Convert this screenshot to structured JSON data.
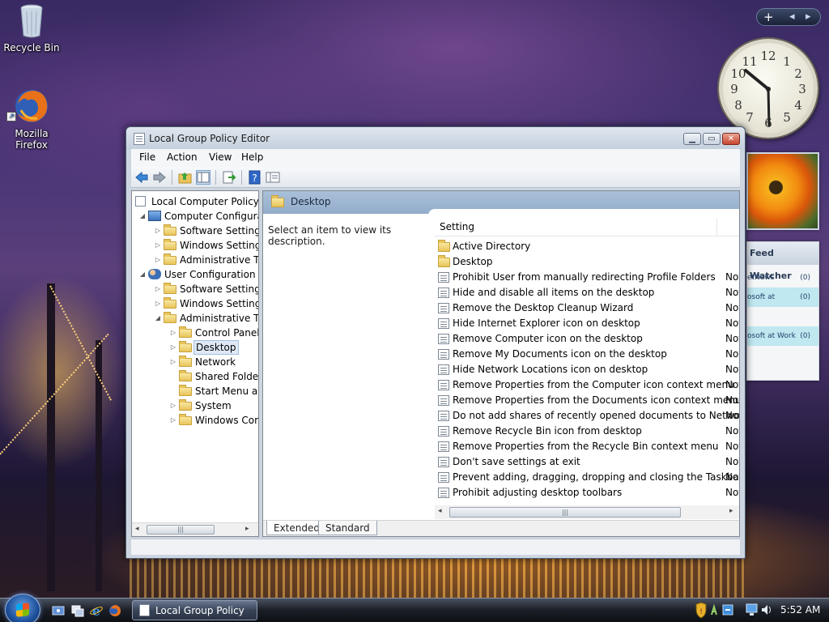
{
  "desktop": {
    "icons": [
      {
        "label": "Recycle Bin",
        "icon": "recycle-bin-icon"
      },
      {
        "label": "Mozilla Firefox",
        "icon": "firefox-icon"
      }
    ]
  },
  "gadgets": {
    "feed_watcher": {
      "title": "Feed Watcher",
      "rows": [
        {
          "text": "etNews",
          "count": "(0)"
        },
        {
          "text": "osoft at",
          "count": "(0)"
        },
        {
          "text": "",
          "count": ""
        },
        {
          "text": "osoft at Work",
          "count": "(0)"
        }
      ]
    }
  },
  "window": {
    "title": "Local Group Policy Editor",
    "menu": [
      "File",
      "Action",
      "View",
      "Help"
    ],
    "toolbar": [
      "back-icon",
      "forward-icon",
      "up-folder-icon",
      "show-hide-tree-icon",
      "export-list-icon",
      "help-icon",
      "properties-icon"
    ],
    "tree": [
      {
        "label": "Local Computer Policy",
        "icon": "policy-icon",
        "expander": ""
      },
      {
        "label": "Computer Configura",
        "icon": "computer-icon",
        "expander": "◢"
      },
      {
        "label": "Software Settings",
        "icon": "folder-icon",
        "expander": "▷"
      },
      {
        "label": "Windows Setting",
        "icon": "folder-icon",
        "expander": "▷"
      },
      {
        "label": "Administrative Te",
        "icon": "folder-icon",
        "expander": "▷"
      },
      {
        "label": "User Configuration",
        "icon": "users-icon",
        "expander": "◢"
      },
      {
        "label": "Software Settings",
        "icon": "folder-icon",
        "expander": "▷"
      },
      {
        "label": "Windows Setting",
        "icon": "folder-icon",
        "expander": "▷"
      },
      {
        "label": "Administrative Te",
        "icon": "folder-icon",
        "expander": "◢"
      },
      {
        "label": "Control Panel",
        "icon": "folder-icon",
        "expander": "▷"
      },
      {
        "label": "Desktop",
        "icon": "folder-icon",
        "expander": "▷",
        "selected": true
      },
      {
        "label": "Network",
        "icon": "folder-icon",
        "expander": "▷"
      },
      {
        "label": "Shared Folder",
        "icon": "folder-icon",
        "expander": ""
      },
      {
        "label": "Start Menu ar",
        "icon": "folder-icon",
        "expander": ""
      },
      {
        "label": "System",
        "icon": "folder-icon",
        "expander": "▷"
      },
      {
        "label": "Windows Cor",
        "icon": "folder-icon",
        "expander": "▷"
      }
    ],
    "right_header": "Desktop",
    "description": "Select an item to view its description.",
    "column_setting": "Setting",
    "settings": [
      {
        "name": "Active Directory",
        "type": "folder",
        "state": ""
      },
      {
        "name": "Desktop",
        "type": "folder",
        "state": ""
      },
      {
        "name": "Prohibit User from manually redirecting Profile Folders",
        "type": "policy",
        "state": "Not"
      },
      {
        "name": "Hide and disable all items on the desktop",
        "type": "policy",
        "state": "Not"
      },
      {
        "name": "Remove the Desktop Cleanup Wizard",
        "type": "policy",
        "state": "Not"
      },
      {
        "name": "Hide Internet Explorer icon on desktop",
        "type": "policy",
        "state": "Not"
      },
      {
        "name": "Remove Computer icon on the desktop",
        "type": "policy",
        "state": "Not"
      },
      {
        "name": "Remove My Documents icon on the desktop",
        "type": "policy",
        "state": "Not"
      },
      {
        "name": "Hide Network Locations icon on desktop",
        "type": "policy",
        "state": "Not"
      },
      {
        "name": "Remove Properties from the Computer icon context menu",
        "type": "policy",
        "state": "Not"
      },
      {
        "name": "Remove Properties from the Documents icon context menu",
        "type": "policy",
        "state": "Not"
      },
      {
        "name": "Do not add shares of recently opened documents to Networ...",
        "type": "policy",
        "state": "Not"
      },
      {
        "name": "Remove Recycle Bin icon from desktop",
        "type": "policy",
        "state": "Not"
      },
      {
        "name": "Remove Properties from the Recycle Bin context menu",
        "type": "policy",
        "state": "Not"
      },
      {
        "name": "Don't save settings at exit",
        "type": "policy",
        "state": "Not"
      },
      {
        "name": "Prevent adding, dragging, dropping and closing the Taskbar...",
        "type": "policy",
        "state": "Not"
      },
      {
        "name": "Prohibit adjusting desktop toolbars",
        "type": "policy",
        "state": "Not"
      }
    ],
    "tabs": [
      {
        "label": "Extended",
        "active": true
      },
      {
        "label": "Standard",
        "active": false
      }
    ]
  },
  "taskbar": {
    "quick_launch": [
      "show-desktop-icon",
      "switch-windows-icon",
      "internet-explorer-icon",
      "firefox-icon"
    ],
    "task_button": "Local Group Policy ...",
    "tray_icons": [
      "security-shield-icon",
      "network-tray-icon",
      "windows-update-icon",
      "monitor-tray-icon",
      "volume-icon"
    ],
    "time": "5:52 AM"
  },
  "colors": {
    "title_header": "#a9c0da",
    "selection": "#dfe9f5",
    "feed_highlight": "#bfe8f0"
  }
}
